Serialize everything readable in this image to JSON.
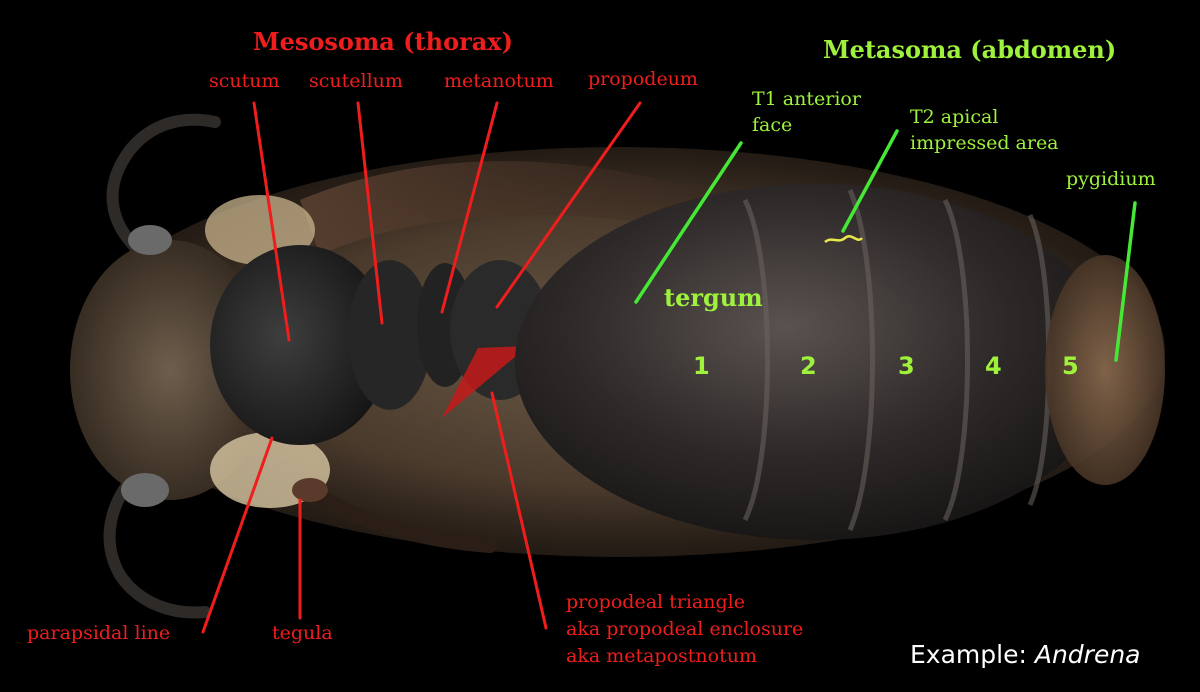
{
  "headings": {
    "mesosoma": "Mesosoma (thorax)",
    "metasoma": "Metasoma (abdomen)"
  },
  "red_labels": {
    "scutum": "scutum",
    "scutellum": "scutellum",
    "metanotum": "metanotum",
    "propodeum": "propodeum",
    "parapsidal_line": "parapsidal line",
    "tegula": "tegula",
    "propodeal_triangle": [
      "propodeal triangle",
      "aka propodeal enclosure",
      "aka metapostnotum"
    ]
  },
  "green_labels": {
    "t1_anterior_face": [
      "T1 anterior",
      "face"
    ],
    "t2_apical": [
      "T2 apical",
      "impressed area"
    ],
    "pygidium": "pygidium",
    "tergum": "tergum",
    "segments": [
      "1",
      "2",
      "3",
      "4",
      "5"
    ]
  },
  "caption": {
    "prefix": "Example:",
    "genus": "Andrena"
  },
  "colors": {
    "background": "#000000",
    "red_annotation": "#f01d1d",
    "green_annotation": "#9ef23c",
    "propodeal_triangle_fill": "#c41a1a",
    "caption_text": "#ffffff"
  }
}
